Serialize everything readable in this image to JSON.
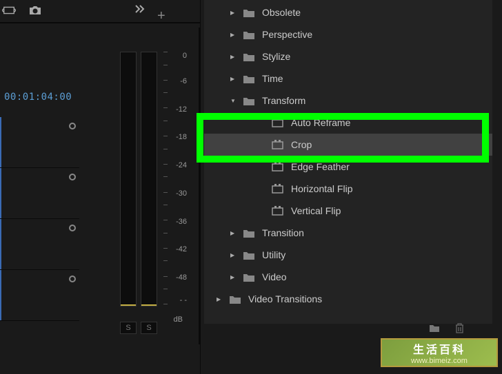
{
  "toolbar": {
    "plus_label": "+",
    "solo_label": "S"
  },
  "timeline": {
    "timecode": "00:01:04:00"
  },
  "audio_meter": {
    "scale": [
      "0",
      "-6",
      "-12",
      "-18",
      "-24",
      "-30",
      "-36",
      "-42",
      "-48",
      "- -"
    ],
    "unit": "dB"
  },
  "effects": {
    "items": [
      {
        "label": "Obsolete",
        "type": "folder",
        "expanded": false,
        "indent": 1
      },
      {
        "label": "Perspective",
        "type": "folder",
        "expanded": false,
        "indent": 1
      },
      {
        "label": "Stylize",
        "type": "folder",
        "expanded": false,
        "indent": 1
      },
      {
        "label": "Time",
        "type": "folder",
        "expanded": false,
        "indent": 1
      },
      {
        "label": "Transform",
        "type": "folder",
        "expanded": true,
        "indent": 1
      },
      {
        "label": "Auto Reframe",
        "type": "preset",
        "indent": 2
      },
      {
        "label": "Crop",
        "type": "preset",
        "indent": 2,
        "selected": true
      },
      {
        "label": "Edge Feather",
        "type": "preset",
        "indent": 2
      },
      {
        "label": "Horizontal Flip",
        "type": "preset",
        "indent": 2
      },
      {
        "label": "Vertical Flip",
        "type": "preset",
        "indent": 2
      },
      {
        "label": "Transition",
        "type": "folder",
        "expanded": false,
        "indent": 1
      },
      {
        "label": "Utility",
        "type": "folder",
        "expanded": false,
        "indent": 1
      },
      {
        "label": "Video",
        "type": "folder",
        "expanded": false,
        "indent": 1
      },
      {
        "label": "Video Transitions",
        "type": "folder",
        "expanded": false,
        "indent": 0
      }
    ]
  },
  "watermark": {
    "title": "生活百科",
    "url": "www.bimeiz.com"
  }
}
